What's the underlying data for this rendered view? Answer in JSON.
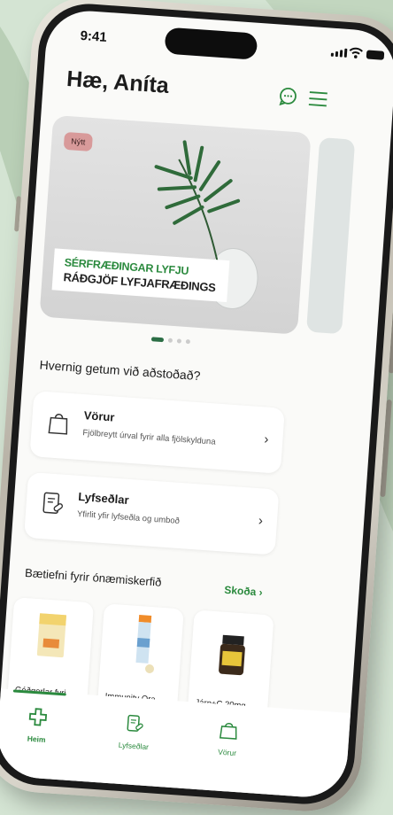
{
  "status": {
    "time": "9:41"
  },
  "header": {
    "greeting": "Hæ, Aníta"
  },
  "banner": {
    "badge": "Nýtt",
    "line1": "SÉRFRÆÐINGAR LYFJU",
    "line2": "RÁÐGJÖF LYFJAFRÆÐINGS"
  },
  "help": {
    "title": "Hvernig getum við aðstoðað?",
    "cards": [
      {
        "title": "Vörur",
        "subtitle": "Fjölbreytt úrval fyrir alla fjölskylduna"
      },
      {
        "title": "Lyfseðlar",
        "subtitle": "Yfirlit yfir lyfseðla og umboð"
      }
    ]
  },
  "products": {
    "title": "Bætiefni fyrir ónæmiskerfið",
    "see_all": "Skoða",
    "items": [
      {
        "name": "Góðgerlar fyri..."
      },
      {
        "name": "Immunity Ora..."
      },
      {
        "name": "Járn+C 20mg"
      }
    ]
  },
  "tabbar": {
    "items": [
      {
        "label": "Heim"
      },
      {
        "label": "Lyfseðlar"
      },
      {
        "label": "Vörur"
      }
    ]
  },
  "colors": {
    "accent": "#2b8a3e",
    "background": "#d4e4d3"
  }
}
